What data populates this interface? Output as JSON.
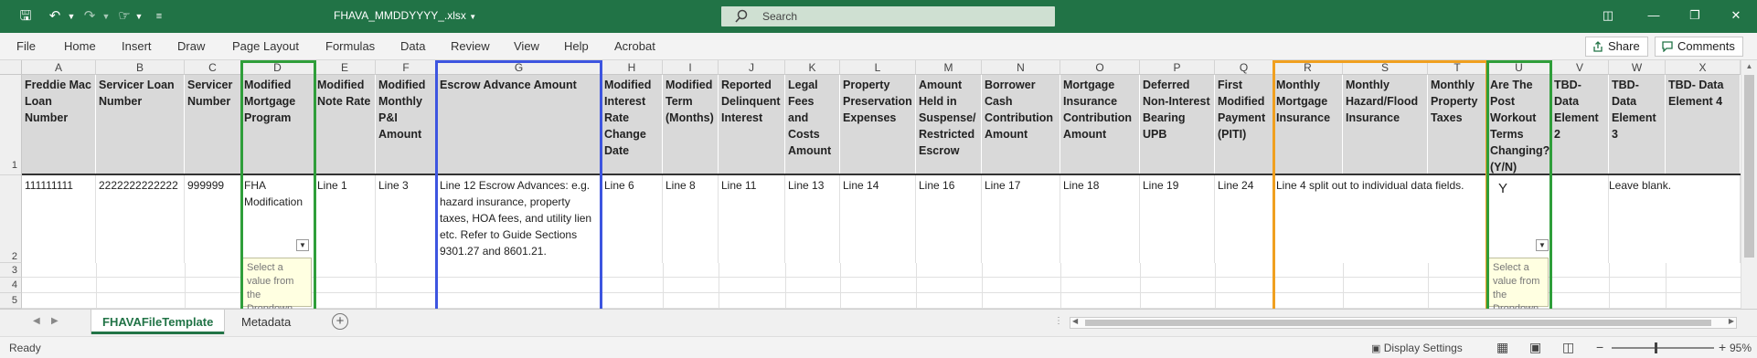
{
  "titlebar": {
    "file_name": "FHAVA_MMDDYYYY_.xlsx",
    "search_placeholder": "Search"
  },
  "ribbon": {
    "tabs": [
      "File",
      "Home",
      "Insert",
      "Draw",
      "Page Layout",
      "Formulas",
      "Data",
      "Review",
      "View",
      "Help",
      "Acrobat"
    ],
    "share_label": "Share",
    "comments_label": "Comments"
  },
  "columns": [
    "A",
    "B",
    "C",
    "D",
    "E",
    "G",
    "H",
    "I",
    "J",
    "K",
    "L",
    "M",
    "N",
    "O",
    "P",
    "Q",
    "R",
    "S",
    "T",
    "U",
    "V",
    "W",
    "X"
  ],
  "rows": [
    "1",
    "2",
    "3",
    "4",
    "5"
  ],
  "headers": {
    "A": "Freddie Mac Loan Number",
    "B": "Servicer Loan Number",
    "C": "Servicer Number",
    "D": "Modified Mortgage Program",
    "E": "Modified Note Rate",
    "F": "Modified Monthly P&I Amount",
    "G": "Escrow Advance Amount",
    "H": "Modified Interest Rate Change Date",
    "I": "Modified Term (Months)",
    "J": "Reported Delinquent Interest",
    "K": "Legal Fees and Costs Amount",
    "L": "Property Preservation Expenses",
    "M": "Amount Held in Suspense/ Restricted Escrow",
    "N": "Borrower Cash Contribution Amount",
    "O": "Mortgage Insurance Contribution Amount",
    "P": "Deferred Non-Interest Bearing UPB",
    "Q": "First Modified Payment (PITI)",
    "R": "Monthly Mortgage Insurance",
    "S": "Monthly Hazard/Flood Insurance",
    "T": "Monthly Property Taxes",
    "U": "Are The Post Workout Terms Changing? (Y/N)",
    "V": "TBD- Data Element 2",
    "W": "TBD- Data Element 3",
    "X": "TBD- Data Element 4"
  },
  "row2": {
    "A": "111111111",
    "B": "2222222222222",
    "C": "999999",
    "D": "FHA Modification",
    "E": "Line 1",
    "F": "Line 3",
    "G": "Line 12 Escrow Advances: e.g. hazard insurance, property taxes, HOA fees, and utility lien etc. Refer to Guide Sections 9301.27 and 8601.21.",
    "H": "Line 6",
    "I": "Line 8",
    "J": "Line 11",
    "K": "Line 13",
    "L": "Line 14",
    "M": "Line 16",
    "N": "Line 17",
    "O": "Line 18",
    "P": "Line 19",
    "Q": "Line 24",
    "R": "Line 4 split out to individual data fields.",
    "U": "Y",
    "W": "Leave blank."
  },
  "tooltip_text": "Select a value from the Dropdown",
  "sheet_tabs": {
    "active": "FHAVAFileTemplate",
    "other": "Metadata"
  },
  "status": {
    "ready": "Ready",
    "display_settings": "Display Settings",
    "zoom": "95%"
  },
  "colors": {
    "excel_green": "#217346",
    "highlight_green": "#2f9e3a",
    "highlight_blue": "#3d55e0",
    "highlight_orange": "#f0a020"
  }
}
